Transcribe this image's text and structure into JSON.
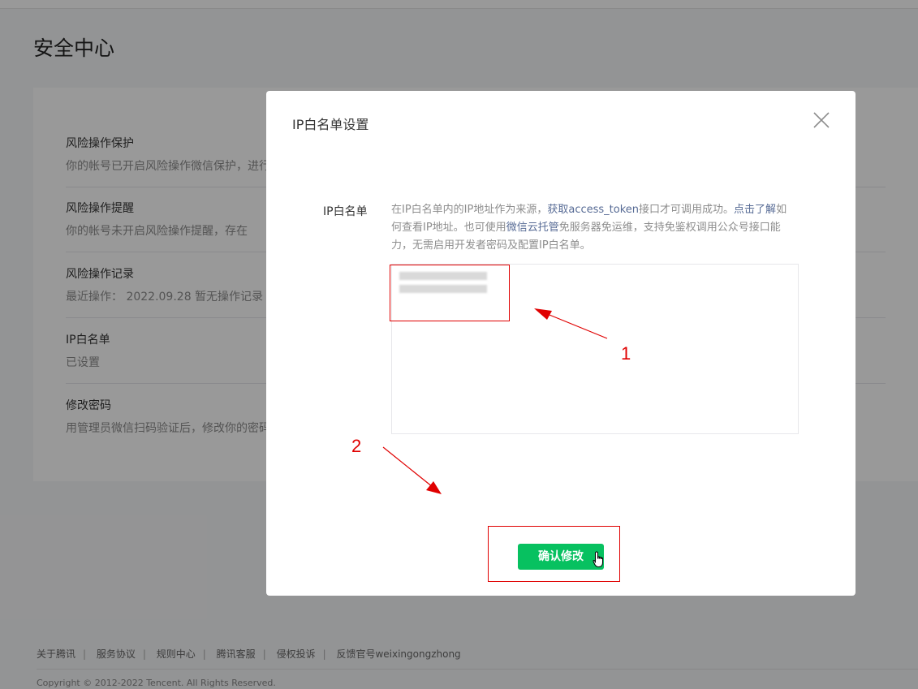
{
  "page": {
    "title": "安全中心"
  },
  "security_items": [
    {
      "title": "风险操作保护",
      "desc": "你的帐号已开启风险操作微信保护，进行"
    },
    {
      "title": "风险操作提醒",
      "desc": "你的帐号未开启风险操作提醒，存在"
    },
    {
      "title": "风险操作记录",
      "desc": "最近操作：  2022.09.28   暂无操作记录"
    },
    {
      "title": "IP白名单",
      "desc": "已设置"
    },
    {
      "title": "修改密码",
      "desc": "用管理员微信扫码验证后，修改你的密码"
    }
  ],
  "modal": {
    "title": "IP白名单设置",
    "close_icon": "close-icon",
    "field_label": "IP白名单",
    "hint": {
      "part1": "在IP白名单内的IP地址作为来源，",
      "link1": "获取access_token",
      "part2": "接口才可调用成功。",
      "link2": "点击了解",
      "part3": "如何查看IP地址。也可使用",
      "link3": "微信云托管",
      "part4": "免服务器免运维，支持免鉴权调用公众号接口能力，无需启用开发者密码及配置IP白名单。"
    },
    "confirm_label": "确认修改"
  },
  "annotations": {
    "label1": "1",
    "label2": "2",
    "color": "#e00000"
  },
  "footer": {
    "links": [
      "关于腾讯",
      "服务协议",
      "规则中心",
      "腾讯客服",
      "侵权投诉",
      "反馈官号weixingongzhong"
    ],
    "copyright": "Copyright © 2012-2022 Tencent. All Rights Reserved."
  },
  "colors": {
    "accent": "#07c160",
    "link": "#576b95"
  }
}
